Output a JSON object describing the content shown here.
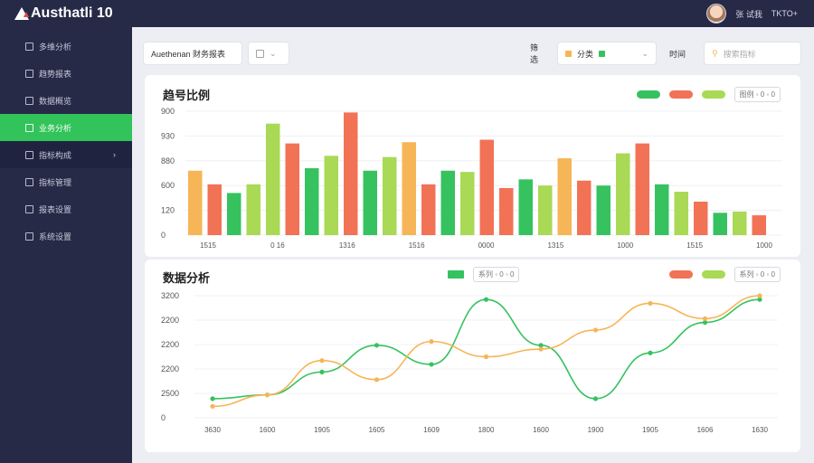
{
  "app": {
    "title": "Austhatli 10"
  },
  "user": {
    "name": "张 试我",
    "role": "TKTO+"
  },
  "sidebar": {
    "items": [
      {
        "label": "多维分析"
      },
      {
        "label": "趋势报表"
      },
      {
        "label": "数据概览"
      },
      {
        "label": "业务分析"
      },
      {
        "label": "指标构成"
      },
      {
        "label": "指标管理"
      },
      {
        "label": "报表设置"
      },
      {
        "label": "系统设置"
      }
    ]
  },
  "filters": {
    "dataset": "Auethenan 财务报表",
    "right1": "筛选",
    "right2": "分类",
    "right3": "时间",
    "search_placeholder": "搜索指标"
  },
  "colors": {
    "green": "#36c25f",
    "red": "#f27256",
    "lime": "#a9d955",
    "orange": "#f6b556"
  },
  "bar_card": {
    "title": "趋号比例",
    "legend_box": "图例 ◦ 0 ◦ 0"
  },
  "line_card": {
    "title": "数据分析",
    "legend_box_left": "系列 ◦ 0 ◦ 0",
    "legend_box_right": "系列 ◦ 0 ◦ 0"
  },
  "chart_data": [
    {
      "type": "bar",
      "title": "趋号比例",
      "categories": [
        "1515",
        "1515",
        "1515",
        "1515",
        "1515",
        "1515",
        "1515",
        "1515",
        "1515",
        "1515"
      ],
      "x_tick_labels": [
        "1515",
        "0 16",
        "1316",
        "1516",
        "0000",
        "1315",
        "1000",
        "1515",
        "1000"
      ],
      "y_tick_labels": [
        "0",
        "120",
        "600",
        "880",
        "930",
        "900"
      ],
      "ylim": [
        0,
        1000
      ],
      "series": [
        {
          "values": [
            520,
            320,
            800,
            450,
            620,
            580,
            120
          ]
        },
        {
          "values": [
            410,
            500,
            780,
            430,
            600,
            400,
            100
          ]
        }
      ],
      "bars": [
        {
          "v": 520,
          "c": "orange"
        },
        {
          "v": 410,
          "c": "red"
        },
        {
          "v": 340,
          "c": "green"
        },
        {
          "v": 410,
          "c": "lime"
        },
        {
          "v": 900,
          "c": "lime"
        },
        {
          "v": 740,
          "c": "red"
        },
        {
          "v": 540,
          "c": "green"
        },
        {
          "v": 640,
          "c": "lime"
        },
        {
          "v": 990,
          "c": "red"
        },
        {
          "v": 520,
          "c": "green"
        },
        {
          "v": 630,
          "c": "lime"
        },
        {
          "v": 750,
          "c": "orange"
        },
        {
          "v": 410,
          "c": "red"
        },
        {
          "v": 520,
          "c": "green"
        },
        {
          "v": 510,
          "c": "lime"
        },
        {
          "v": 770,
          "c": "red"
        },
        {
          "v": 380,
          "c": "red"
        },
        {
          "v": 450,
          "c": "green"
        },
        {
          "v": 400,
          "c": "lime"
        },
        {
          "v": 620,
          "c": "orange"
        },
        {
          "v": 440,
          "c": "red"
        },
        {
          "v": 400,
          "c": "green"
        },
        {
          "v": 660,
          "c": "lime"
        },
        {
          "v": 740,
          "c": "red"
        },
        {
          "v": 410,
          "c": "green"
        },
        {
          "v": 350,
          "c": "lime"
        },
        {
          "v": 270,
          "c": "red"
        },
        {
          "v": 180,
          "c": "green"
        },
        {
          "v": 190,
          "c": "lime"
        },
        {
          "v": 160,
          "c": "red"
        }
      ]
    },
    {
      "type": "line",
      "title": "数据分析",
      "x_tick_labels": [
        "3630",
        "1600",
        "1905",
        "1605",
        "1609",
        "1800",
        "1600",
        "1900",
        "1905",
        "1606",
        "1630"
      ],
      "y_tick_labels": [
        "0",
        "2500",
        "2200",
        "2200",
        "2200",
        "3200"
      ],
      "ylim": [
        0,
        3200
      ],
      "series": [
        {
          "name": "green",
          "values": [
            500,
            600,
            1200,
            1900,
            1400,
            3100,
            1900,
            500,
            1700,
            2500,
            3100
          ]
        },
        {
          "name": "orange",
          "values": [
            300,
            600,
            1500,
            1000,
            2000,
            1600,
            1800,
            2300,
            3000,
            2600,
            3200
          ]
        }
      ]
    }
  ]
}
